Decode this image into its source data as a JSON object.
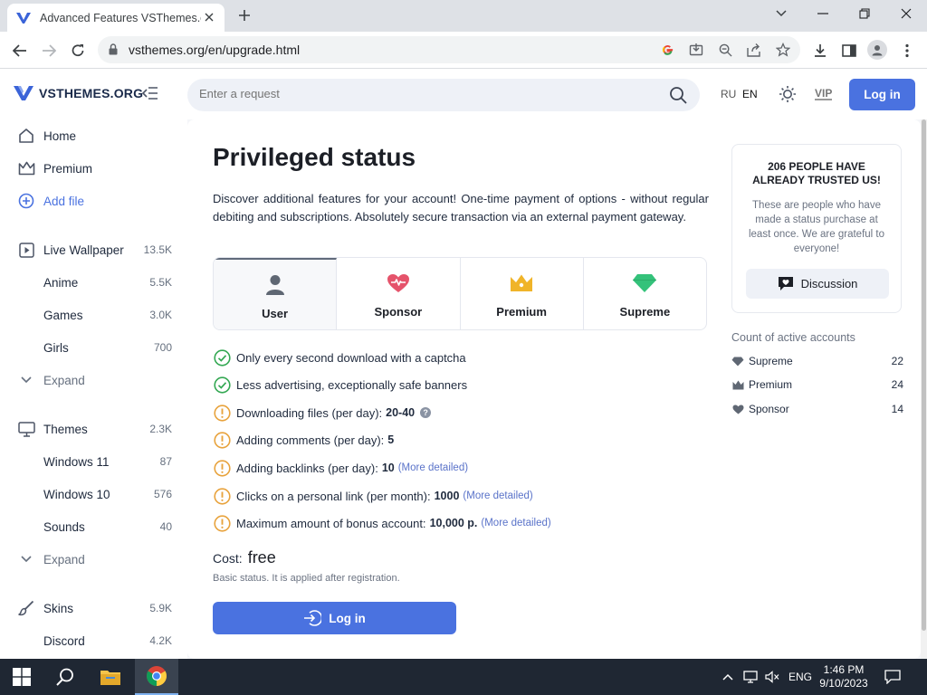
{
  "browser": {
    "tab_title": "Advanced Features VSThemes.org",
    "url": "vsthemes.org/en/upgrade.html"
  },
  "header": {
    "logo_text": "VSTHEMES.ORG",
    "search_placeholder": "Enter a request",
    "lang_ru": "RU",
    "lang_en": "EN",
    "vip": "VIP",
    "login": "Log in"
  },
  "sidebar": {
    "items": [
      {
        "label": "Home",
        "count": "",
        "icon": "home-icon"
      },
      {
        "label": "Premium",
        "count": "",
        "icon": "crown-icon"
      },
      {
        "label": "Add file",
        "count": "",
        "icon": "plus-circle-icon"
      },
      {
        "label": "Live Wallpaper",
        "count": "13.5K",
        "icon": "play-icon"
      },
      {
        "label": "Anime",
        "count": "5.5K"
      },
      {
        "label": "Games",
        "count": "3.0K"
      },
      {
        "label": "Girls",
        "count": "700"
      },
      {
        "label": "Expand",
        "count": "",
        "icon": "chevron-down-icon"
      },
      {
        "label": "Themes",
        "count": "2.3K",
        "icon": "monitor-icon"
      },
      {
        "label": "Windows 11",
        "count": "87"
      },
      {
        "label": "Windows 10",
        "count": "576"
      },
      {
        "label": "Sounds",
        "count": "40"
      },
      {
        "label": "Expand",
        "count": "",
        "icon": "chevron-down-icon"
      },
      {
        "label": "Skins",
        "count": "5.9K",
        "icon": "brush-icon"
      },
      {
        "label": "Discord",
        "count": "4.2K"
      }
    ]
  },
  "main": {
    "title": "Privileged status",
    "lead": "Discover additional features for your account! One-time payment of options - without regular debiting and subscriptions. Absolutely secure transaction via an external payment gateway.",
    "plans": [
      {
        "name": "User",
        "icon": "user-icon",
        "color": "#5f6773"
      },
      {
        "name": "Sponsor",
        "icon": "heart-pulse-icon",
        "color": "#e5536b"
      },
      {
        "name": "Premium",
        "icon": "crown-icon",
        "color": "#f0b429"
      },
      {
        "name": "Supreme",
        "icon": "diamond-icon",
        "color": "#34c27a"
      }
    ],
    "features": [
      {
        "text": "Only every second download with a captcha",
        "value": "",
        "more": "",
        "status": "check"
      },
      {
        "text": "Less advertising, exceptionally safe banners",
        "value": "",
        "more": "",
        "status": "check"
      },
      {
        "text": "Downloading files (per day):",
        "value": "20-40",
        "more": "",
        "status": "warn",
        "help": "?"
      },
      {
        "text": "Adding comments (per day):",
        "value": "5",
        "more": "",
        "status": "warn"
      },
      {
        "text": "Adding backlinks (per day):",
        "value": "10",
        "more": "(More detailed)",
        "status": "warn"
      },
      {
        "text": "Clicks on a personal link (per month):",
        "value": "1000",
        "more": "(More detailed)",
        "status": "warn"
      },
      {
        "text": "Maximum amount of bonus account:",
        "value": "10,000 р.",
        "more": "(More detailed)",
        "status": "warn"
      }
    ],
    "cost_label": "Cost:",
    "cost_value": "free",
    "cost_note": "Basic status. It is applied after registration.",
    "login_button": "Log in"
  },
  "aside": {
    "trust_title": "206 PEOPLE HAVE ALREADY TRUSTED US!",
    "trust_text": "These are people who have made a status purchase at least once. We are grateful to everyone!",
    "discussion": "Discussion",
    "accounts_title": "Count of active accounts",
    "accounts": [
      {
        "name": "Supreme",
        "count": "22",
        "icon": "diamond-icon"
      },
      {
        "name": "Premium",
        "count": "24",
        "icon": "crown-icon"
      },
      {
        "name": "Sponsor",
        "count": "14",
        "icon": "heart-icon"
      }
    ]
  },
  "taskbar": {
    "lang": "ENG",
    "time": "1:46 PM",
    "date": "9/10/2023"
  },
  "colors": {
    "accent": "#4a72e0",
    "check": "#34a853",
    "warn": "#e8a33d"
  }
}
